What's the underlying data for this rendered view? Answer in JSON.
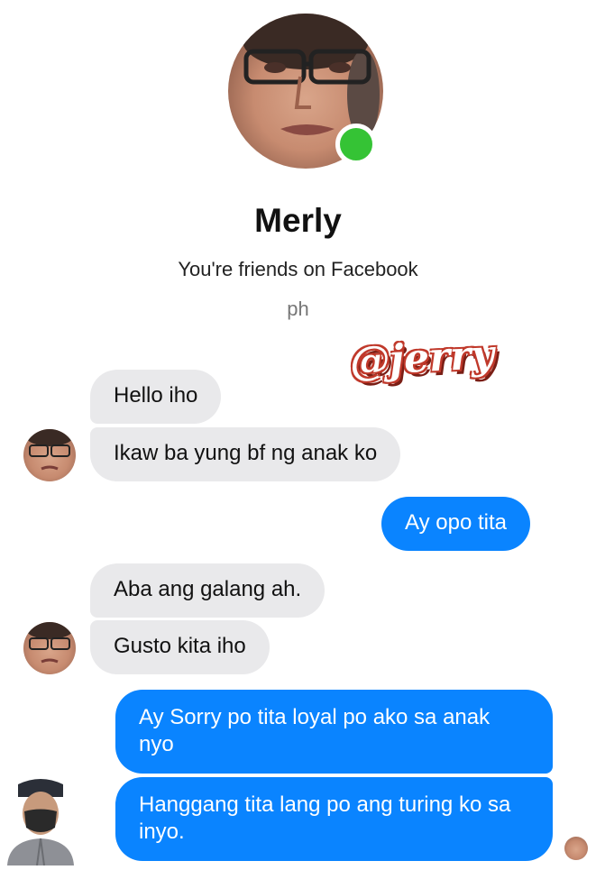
{
  "profile": {
    "name": "Merly",
    "relation": "You're friends on Facebook",
    "location": "ph",
    "online": true,
    "online_color": "#35c335"
  },
  "watermark": "@jerry",
  "messages": [
    {
      "from": "contact",
      "text": "Hello iho"
    },
    {
      "from": "contact",
      "text": "Ikaw ba yung bf ng anak ko"
    },
    {
      "from": "me",
      "text": "Ay opo tita"
    },
    {
      "from": "contact",
      "text": "Aba ang galang ah."
    },
    {
      "from": "contact",
      "text": "Gusto kita iho"
    },
    {
      "from": "me",
      "text": "Ay Sorry po tita loyal po ako sa anak nyo"
    },
    {
      "from": "me",
      "text": "Hanggang tita lang po ang turing ko sa inyo."
    }
  ],
  "colors": {
    "outgoing_bubble": "#0a84ff",
    "incoming_bubble": "#e9e9eb"
  }
}
